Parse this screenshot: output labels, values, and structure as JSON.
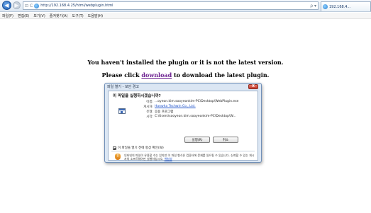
{
  "browser": {
    "address": "http://192.168.4.25/html/webplugin.html",
    "address_actions": "ρ ▾",
    "tab_title": "192.168.4..."
  },
  "menu": [
    "파일(F)",
    "편집(E)",
    "보기(V)",
    "즐겨찾기(A)",
    "도구(T)",
    "도움말(H)"
  ],
  "page": {
    "message_line1": "You haven't installed the plugin or it is not the latest version.",
    "message_line2_prefix": "Please click ",
    "download_link": "download",
    "message_line2_suffix": " to download the latest plugin."
  },
  "dialog": {
    "title": "파일 열기 - 보안 경고",
    "close_label": "X",
    "question": "이 파일을 실행하시겠습니까?",
    "fields": [
      {
        "label": "이름:",
        "value": "...oyeon.kim.sooyeonkim-PC\\Desktop\\WebPlugin.exe",
        "link": false
      },
      {
        "label": "게시자:",
        "value": "Hanwha Techwin Co., Ltd.",
        "link": true
      },
      {
        "label": "유형:",
        "value": "응용 프로그램",
        "link": false
      },
      {
        "label": "시작:",
        "value": "C:\\Users\\sooyeon.kim.sooyeonkim-PC\\Desktop\\W...",
        "link": false
      }
    ],
    "run_label": "실행(R)",
    "cancel_label": "취소",
    "checkbox_label": "이 파일을 열기 전에 항상 확인(W)",
    "checkbox_checked": true,
    "warning_text": "인터넷의 파일이 유용할 수는 있지만 이 파일 형식은 컴퓨터에 문제를 일으킬 수 있습니다. 신뢰할 수 있는 게시자의 소프트웨어만 실행하십시오.",
    "warning_link": "위험성"
  }
}
